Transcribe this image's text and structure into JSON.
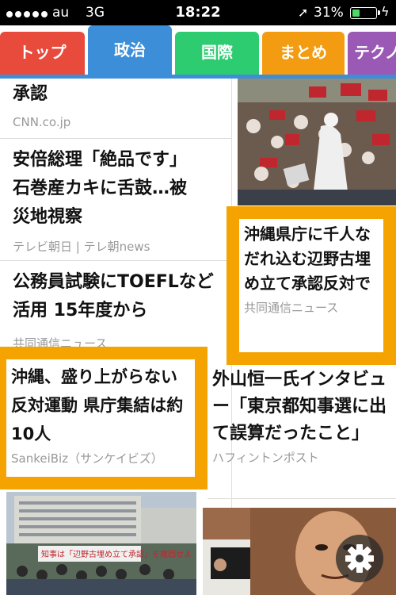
{
  "status_bar": {
    "carrier": "au",
    "network": "3G",
    "time": "18:22",
    "battery_percent": "31%",
    "battery_level": 0.31,
    "icons": [
      "signal-dots-icon",
      "location-arrow-icon",
      "battery-icon",
      "charging-bolt-icon"
    ]
  },
  "tabs": [
    {
      "label": "トップ",
      "color": "#e84b3c",
      "active": false
    },
    {
      "label": "政治",
      "color": "#3c8ed8",
      "active": true
    },
    {
      "label": "国際",
      "color": "#2ecc71",
      "active": false
    },
    {
      "label": "まとめ",
      "color": "#f39c12",
      "active": false
    },
    {
      "label": "テクノ",
      "color": "#9b59b6",
      "active": false
    }
  ],
  "news_left": [
    {
      "title": "承認",
      "source": "CNN.co.jp"
    },
    {
      "title": "安倍総理「絶品です」石巻産カキに舌鼓…被災地視察",
      "source": "テレビ朝日 | テレ朝news"
    },
    {
      "title": "公務員試験にTOEFLなど活用 15年度から",
      "source": "共同通信ニュース"
    }
  ],
  "highlighted_right": {
    "title": "沖縄県庁に千人なだれ込む辺野古埋め立て承認反対で",
    "source": "共同通信ニュース"
  },
  "highlighted_left": {
    "title": "沖縄、盛り上がらない反対運動 県庁集結は約10人",
    "source": "SankeiBiz（サンケイビズ）"
  },
  "news_right_bottom": {
    "title": "外山恒一氏インタビュー「東京都知事選に出て誤算だったこと」",
    "source": "ハフィントンポスト"
  },
  "photo_captions": {
    "banner_text": "知事は「辺野古埋め立て承認」を撤回せよ"
  },
  "colors": {
    "highlight": "#f5a300",
    "accent_blue": "#3c8ed8"
  }
}
